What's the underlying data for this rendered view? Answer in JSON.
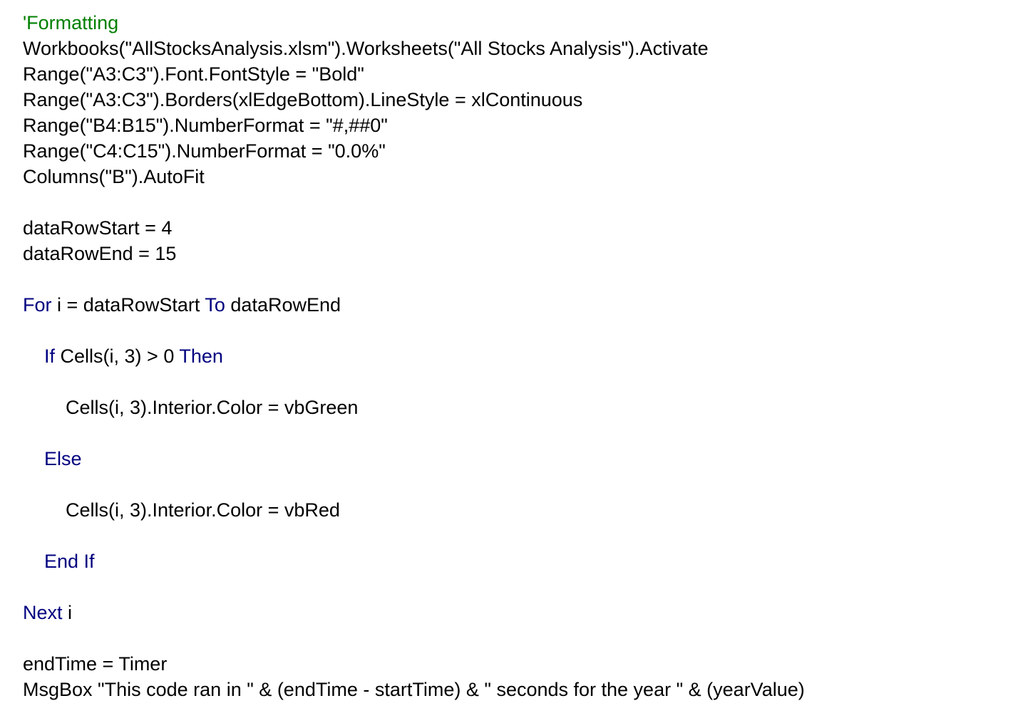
{
  "colors": {
    "text": "#000000",
    "keyword": "#00007f",
    "comment": "#007f00",
    "background": "#ffffff"
  },
  "lines": [
    [
      {
        "t": "'Formatting",
        "k": "comment"
      }
    ],
    [
      {
        "t": "Workbooks(\"AllStocksAnalysis.xlsm\").Worksheets(\"All Stocks Analysis\").Activate",
        "k": "text"
      }
    ],
    [
      {
        "t": "Range(\"A3:C3\").Font.FontStyle = \"Bold\"",
        "k": "text"
      }
    ],
    [
      {
        "t": "Range(\"A3:C3\").Borders(xlEdgeBottom).LineStyle = xlContinuous",
        "k": "text"
      }
    ],
    [
      {
        "t": "Range(\"B4:B15\").NumberFormat = \"#,##0\"",
        "k": "text"
      }
    ],
    [
      {
        "t": "Range(\"C4:C15\").NumberFormat = \"0.0%\"",
        "k": "text"
      }
    ],
    [
      {
        "t": "Columns(\"B\").AutoFit",
        "k": "text"
      }
    ],
    [],
    [
      {
        "t": "dataRowStart = 4",
        "k": "text"
      }
    ],
    [
      {
        "t": "dataRowEnd = 15",
        "k": "text"
      }
    ],
    [],
    [
      {
        "t": "For",
        "k": "keyword"
      },
      {
        "t": " i = dataRowStart ",
        "k": "text"
      },
      {
        "t": "To",
        "k": "keyword"
      },
      {
        "t": " dataRowEnd",
        "k": "text"
      }
    ],
    [],
    [
      {
        "t": "    ",
        "k": "text"
      },
      {
        "t": "If",
        "k": "keyword"
      },
      {
        "t": " Cells(i, 3) > 0 ",
        "k": "text"
      },
      {
        "t": "Then",
        "k": "keyword"
      }
    ],
    [],
    [
      {
        "t": "        Cells(i, 3).Interior.Color = vbGreen",
        "k": "text"
      }
    ],
    [],
    [
      {
        "t": "    ",
        "k": "text"
      },
      {
        "t": "Else",
        "k": "keyword"
      }
    ],
    [],
    [
      {
        "t": "        Cells(i, 3).Interior.Color = vbRed",
        "k": "text"
      }
    ],
    [],
    [
      {
        "t": "    ",
        "k": "text"
      },
      {
        "t": "End If",
        "k": "keyword"
      }
    ],
    [],
    [
      {
        "t": "Next",
        "k": "keyword"
      },
      {
        "t": " i",
        "k": "text"
      }
    ],
    [],
    [
      {
        "t": "endTime = Timer",
        "k": "text"
      }
    ],
    [
      {
        "t": "MsgBox \"This code ran in \" & (endTime - startTime) & \" seconds for the year \" & (yearValue)",
        "k": "text"
      }
    ]
  ]
}
